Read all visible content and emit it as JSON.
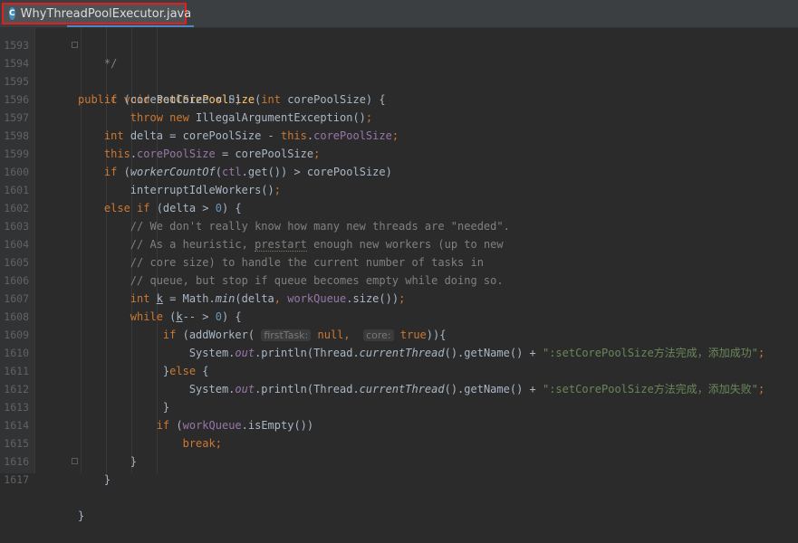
{
  "tab": {
    "filename": "WhyThreadPoolExecutor.java",
    "icon_letter": "C"
  },
  "lines": {
    "l1593": "1593",
    "l1594": "1594",
    "l1595": "1595",
    "l1596": "1596",
    "l1597": "1597",
    "l1598": "1598",
    "l1599": "1599",
    "l1600": "1600",
    "l1601": "1601",
    "l1602": "1602",
    "l1603": "1603",
    "l1604": "1604",
    "l1605": "1605",
    "l1606": "1606",
    "l1607": "1607",
    "l1608": "1608",
    "l1609": "1609",
    "l1610": "1610",
    "l1611": "1611",
    "l1612": "1612",
    "l1613": "1613",
    "l1614": "1614",
    "l1615": "1615",
    "l1616": "1616",
    "l1617": "1617"
  },
  "code": {
    "c1593": "*/",
    "c1602": "// We don't really know how many new threads are \"needed\".",
    "c1603a": "// As a heuristic, ",
    "c1603b": "prestart",
    "c1603c": " enough new workers (up to new",
    "c1604": "// core size) to handle the current number of tasks in",
    "c1605": "// queue, but stop if queue becomes empty while doing so.",
    "hint_first": "firstTask:",
    "hint_core": "core:",
    "str_success": "\":setCorePoolSize方法完成，添加成功\"",
    "str_fail": "\":setCorePoolSize方法完成，添加失败\""
  }
}
